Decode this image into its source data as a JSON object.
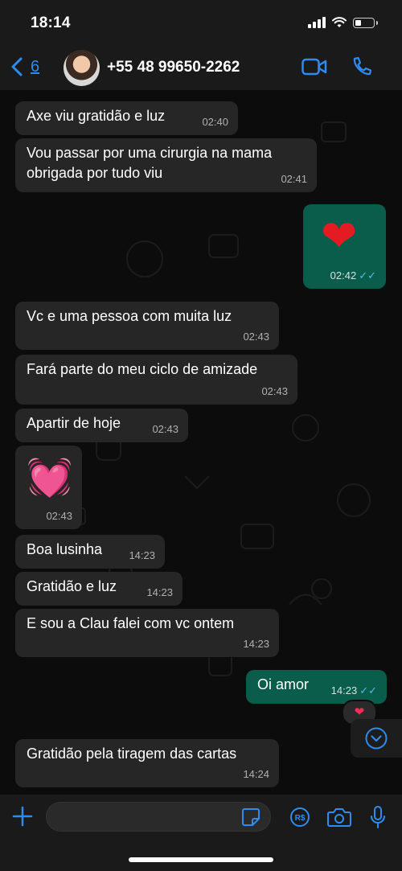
{
  "status_bar": {
    "time": "18:14"
  },
  "header": {
    "back_count": "6",
    "contact_name": "+55 48 99650-2262"
  },
  "messages": [
    {
      "text": "Axe viu gratidão e luz",
      "time": "02:40"
    },
    {
      "text_line1": "Vou passar por uma cirurgia na mama",
      "text_line2": "obrigada por tudo viu",
      "time": "02:41"
    },
    {
      "emoji": "❤",
      "time": "02:42",
      "ticks": "✓✓"
    },
    {
      "text": "Vc e uma pessoa com muita luz",
      "time": "02:43"
    },
    {
      "text": "Fará parte do meu ciclo de amizade",
      "time": "02:43"
    },
    {
      "text": "Apartir de hoje",
      "time": "02:43"
    },
    {
      "emoji": "💓",
      "time": "02:43"
    },
    {
      "text": "Boa lusinha",
      "time": "14:23"
    },
    {
      "text": "Gratidão e luz",
      "time": "14:23"
    },
    {
      "text": "E sou a Clau falei com vc ontem",
      "time": "14:23"
    },
    {
      "text": "Oi amor",
      "time": "14:23",
      "ticks": "✓✓",
      "reaction": "❤"
    },
    {
      "text": "Gratidão pela tiragem das cartas",
      "time": "14:24"
    }
  ],
  "input": {
    "placeholder": ""
  },
  "colors": {
    "accent": "#2d8cf0",
    "outgoing_bubble": "#0b5d4b",
    "incoming_bubble": "#262626",
    "read_ticks": "#53bdeb"
  }
}
